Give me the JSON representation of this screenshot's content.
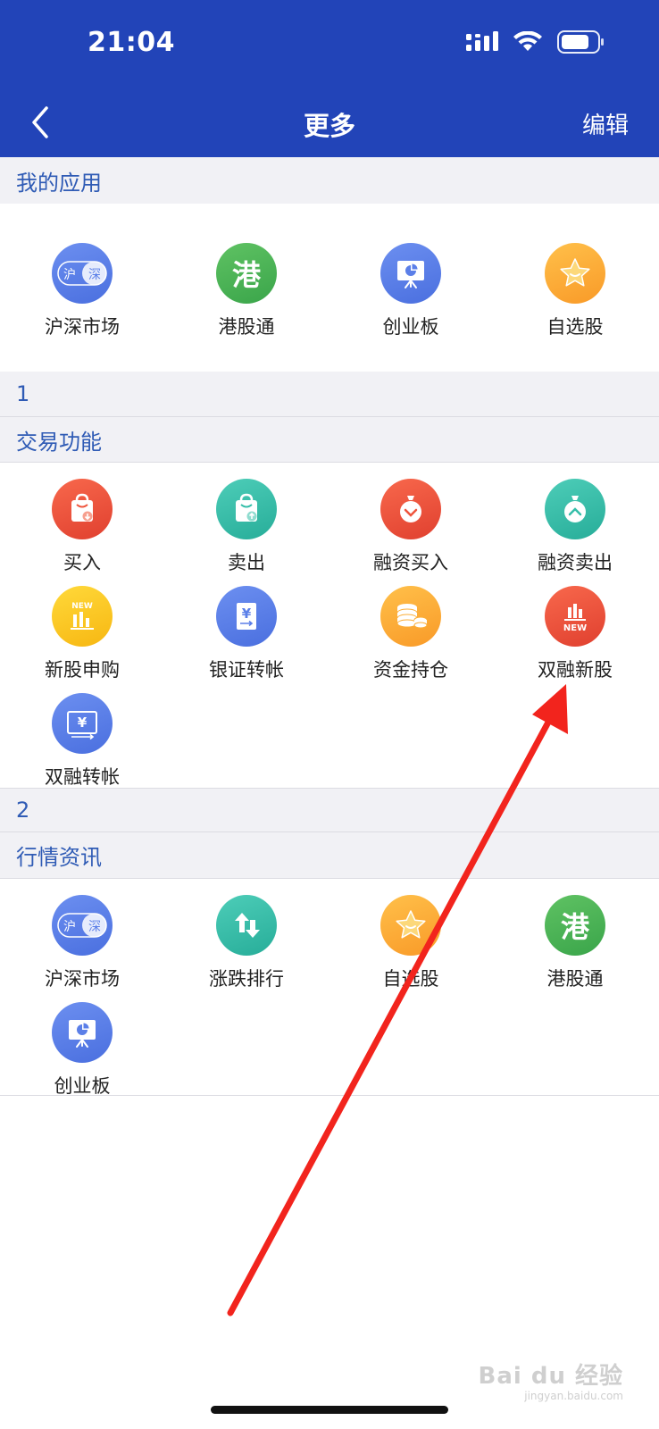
{
  "status_bar": {
    "time": "21:04"
  },
  "nav": {
    "title": "更多",
    "edit_label": "编辑"
  },
  "my_apps": {
    "heading": "我的应用",
    "items": [
      {
        "label": "沪深市场",
        "icon": "hu-shen-icon",
        "color": "#5b7fe8"
      },
      {
        "label": "港股通",
        "icon": "hk-icon",
        "color": "#4cb557"
      },
      {
        "label": "创业板",
        "icon": "presentation-chart-icon",
        "color": "#5b7fe8"
      },
      {
        "label": "自选股",
        "icon": "star-icon",
        "color": "#fbad36"
      }
    ]
  },
  "sections": [
    {
      "number": "1",
      "heading": "交易功能",
      "items": [
        {
          "label": "买入",
          "icon": "shopping-bag-down-icon",
          "color": "#ef543c"
        },
        {
          "label": "卖出",
          "icon": "shopping-bag-up-icon",
          "color": "#35bea9"
        },
        {
          "label": "融资买入",
          "icon": "money-bag-down-icon",
          "color": "#ef543c"
        },
        {
          "label": "融资卖出",
          "icon": "money-bag-up-icon",
          "color": "#35bea9"
        },
        {
          "label": "新股申购",
          "icon": "new-stock-chart-icon",
          "badge": "NEW",
          "color": "#f9c825"
        },
        {
          "label": "银证转帐",
          "icon": "yen-document-icon",
          "color": "#5b7fe8"
        },
        {
          "label": "资金持仓",
          "icon": "coins-icon",
          "color": "#fbad36"
        },
        {
          "label": "双融新股",
          "icon": "new-stock-bars-icon",
          "badge": "NEW",
          "color": "#ef543c"
        },
        {
          "label": "双融转帐",
          "icon": "yen-transfer-icon",
          "color": "#5b7fe8"
        }
      ]
    },
    {
      "number": "2",
      "heading": "行情资讯",
      "items": [
        {
          "label": "沪深市场",
          "icon": "hu-shen-icon",
          "color": "#5b7fe8"
        },
        {
          "label": "涨跌排行",
          "icon": "up-down-arrows-icon",
          "color": "#35bea9"
        },
        {
          "label": "自选股",
          "icon": "star-icon",
          "color": "#fbad36"
        },
        {
          "label": "港股通",
          "icon": "hk-icon",
          "color": "#4cb557"
        },
        {
          "label": "创业板",
          "icon": "presentation-chart-icon",
          "color": "#5b7fe8"
        }
      ]
    }
  ],
  "icon_text": {
    "hu": "沪",
    "shen": "深",
    "gang": "港",
    "yen": "¥",
    "new": "NEW"
  },
  "watermark": {
    "brand": "Bai du 经验",
    "url": "jingyan.baidu.com"
  },
  "colors": {
    "header": "#2244b8",
    "section_bg": "#f1f1f5",
    "section_text": "#2f5bb5",
    "annotation_arrow": "#f2241d"
  }
}
